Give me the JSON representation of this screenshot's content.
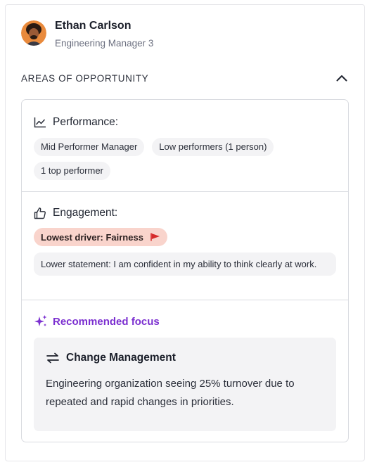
{
  "person": {
    "name": "Ethan Carlson",
    "role": "Engineering Manager 3",
    "avatar_icon": "person-avatar"
  },
  "section": {
    "title": "AREAS OF OPPORTUNITY",
    "toggle_icon": "chevron-up-icon"
  },
  "performance": {
    "title": "Performance:",
    "icon": "line-chart-icon",
    "chips": [
      "Mid Performer Manager",
      "Low performers (1 person)",
      "1 top performer"
    ]
  },
  "engagement": {
    "title": "Engagement:",
    "icon": "thumbs-up-icon",
    "lowest_driver": "Lowest driver: Fairness",
    "flag_icon": "flag-icon",
    "flag_color": "#d62a2a",
    "statement": "Lower statement: I am confident in my ability to think clearly at work."
  },
  "recommended": {
    "title": "Recommended focus",
    "icon": "sparkle-icon",
    "accent": "#7b2fd0",
    "focus_title": "Change Management",
    "focus_icon": "swap-arrows-icon",
    "focus_body": "Engineering organization seeing 25% turnover due to repeated and rapid changes in priorities."
  }
}
